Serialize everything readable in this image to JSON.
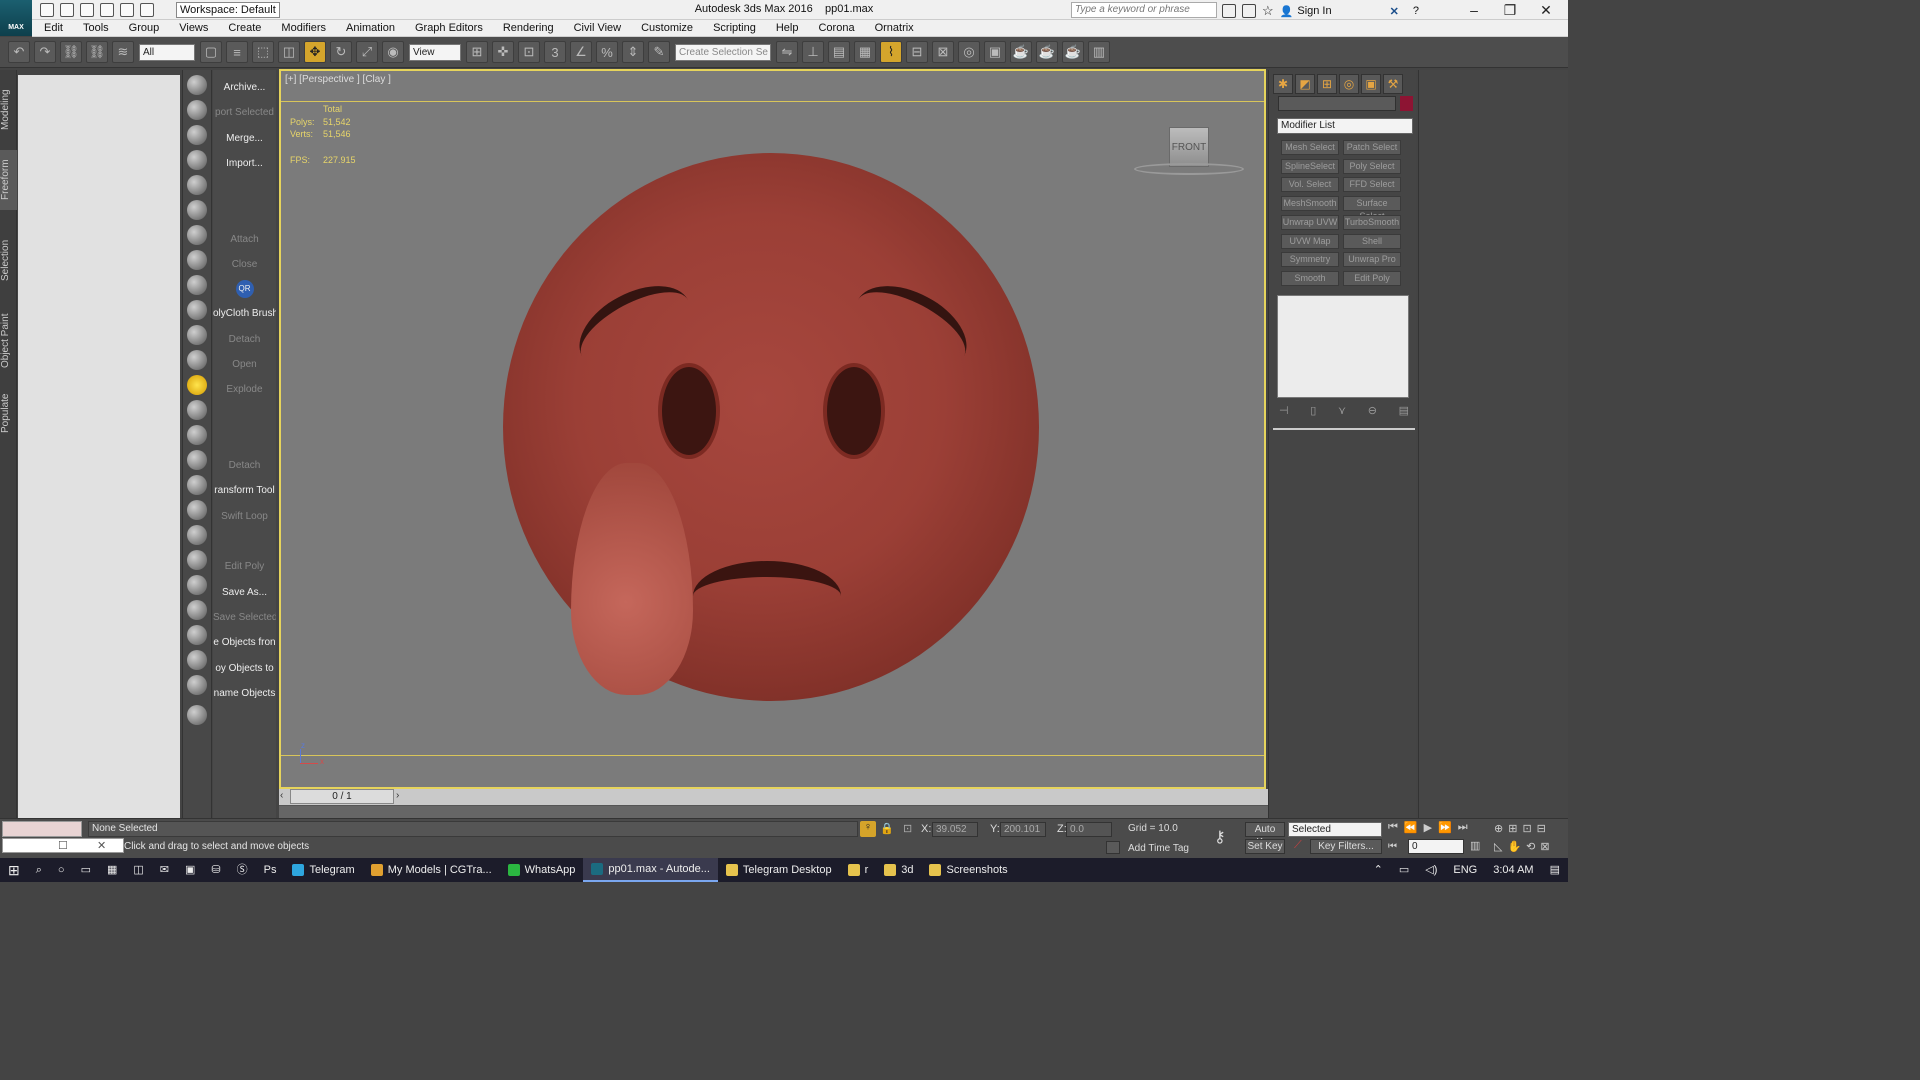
{
  "app": {
    "title": "Autodesk 3ds Max 2016",
    "file": "pp01.max",
    "logo_text": "MAX",
    "workspace": "Workspace: Default",
    "search_placeholder": "Type a keyword or phrase",
    "sign_in": "Sign In"
  },
  "menu": [
    "Edit",
    "Tools",
    "Group",
    "Views",
    "Create",
    "Modifiers",
    "Animation",
    "Graph Editors",
    "Rendering",
    "Civil View",
    "Customize",
    "Scripting",
    "Help",
    "Corona",
    "Ornatrix"
  ],
  "toolbar": {
    "filter_value": "All",
    "refcoord_value": "View",
    "selection_set_placeholder": "Create Selection Se"
  },
  "ribbon_tabs": [
    "Modeling",
    "Freeform",
    "Selection",
    "Object Paint",
    "Populate"
  ],
  "command_column": [
    {
      "label": "Archive...",
      "dim": false
    },
    {
      "label": "port Selected",
      "dim": true
    },
    {
      "label": "Merge...",
      "dim": false
    },
    {
      "label": "Import...",
      "dim": false
    },
    {
      "label": "",
      "dim": false
    },
    {
      "label": "",
      "dim": false
    },
    {
      "label": "Attach",
      "dim": true
    },
    {
      "label": "Close",
      "dim": true
    },
    {
      "label": "QR",
      "dim": false
    },
    {
      "label": "olyCloth Brush",
      "dim": false
    },
    {
      "label": "Detach",
      "dim": true
    },
    {
      "label": "Open",
      "dim": true
    },
    {
      "label": "Explode",
      "dim": true
    },
    {
      "label": "",
      "dim": false
    },
    {
      "label": "",
      "dim": false
    },
    {
      "label": "Detach",
      "dim": true
    },
    {
      "label": "ransform Tool",
      "dim": false
    },
    {
      "label": "Swift Loop",
      "dim": true
    },
    {
      "label": "",
      "dim": false
    },
    {
      "label": "Edit Poly",
      "dim": true
    },
    {
      "label": "Save As...",
      "dim": false
    },
    {
      "label": "Save Selected",
      "dim": true
    },
    {
      "label": "e Objects fron",
      "dim": false
    },
    {
      "label": "oy Objects to",
      "dim": false
    },
    {
      "label": "name Objects",
      "dim": false
    }
  ],
  "viewport": {
    "label": "[+] [Perspective ] [Clay ]",
    "stats_header": "Total",
    "polys_label": "Polys:",
    "polys_value": "51,542",
    "verts_label": "Verts:",
    "verts_value": "51,546",
    "fps_label": "FPS:",
    "fps_value": "227.915",
    "viewcube": "FRONT",
    "axis_z": "z",
    "axis_x": "x"
  },
  "timeline": {
    "frame": "0 / 1"
  },
  "command_panel": {
    "modifier_list": "Modifier List",
    "swatch_color": "#8d1433",
    "buttons": [
      "Mesh Select",
      "Patch Select",
      "SplineSelect",
      "Poly Select",
      "Vol. Select",
      "FFD Select",
      "MeshSmooth",
      "Surface Select",
      "Unwrap UVW",
      "TurboSmooth",
      "UVW Map",
      "Shell",
      "Symmetry",
      "Unwrap Pro",
      "Smooth",
      "Edit Poly"
    ]
  },
  "status": {
    "selection": "None Selected",
    "prompt": "Click and drag to select and move objects",
    "x_label": "X:",
    "x_value": "39.052",
    "y_label": "Y:",
    "y_value": "200.101",
    "z_label": "Z:",
    "z_value": "0.0",
    "grid": "Grid = 10.0",
    "add_time_tag": "Add Time Tag",
    "auto_key": "Auto Key",
    "set_key": "Set Key",
    "key_mode": "Selected",
    "key_filters": "Key Filters...",
    "current_frame": "0"
  },
  "taskbar": {
    "items": [
      {
        "label": "Telegram",
        "color": "#2ea6de",
        "active": false
      },
      {
        "label": "My Models | CGTra...",
        "color": "#e0a030",
        "active": false
      },
      {
        "label": "WhatsApp",
        "color": "#2bb741",
        "active": false
      },
      {
        "label": "pp01.max - Autode...",
        "color": "#1b6b80",
        "active": true
      },
      {
        "label": "Telegram Desktop",
        "color": "#e6c34d",
        "active": false
      },
      {
        "label": "r",
        "color": "#e6c34d",
        "active": false
      },
      {
        "label": "3d",
        "color": "#e6c34d",
        "active": false
      },
      {
        "label": "Screenshots",
        "color": "#e6c34d",
        "active": false
      }
    ],
    "lang": "ENG",
    "time": "3:04 AM"
  }
}
